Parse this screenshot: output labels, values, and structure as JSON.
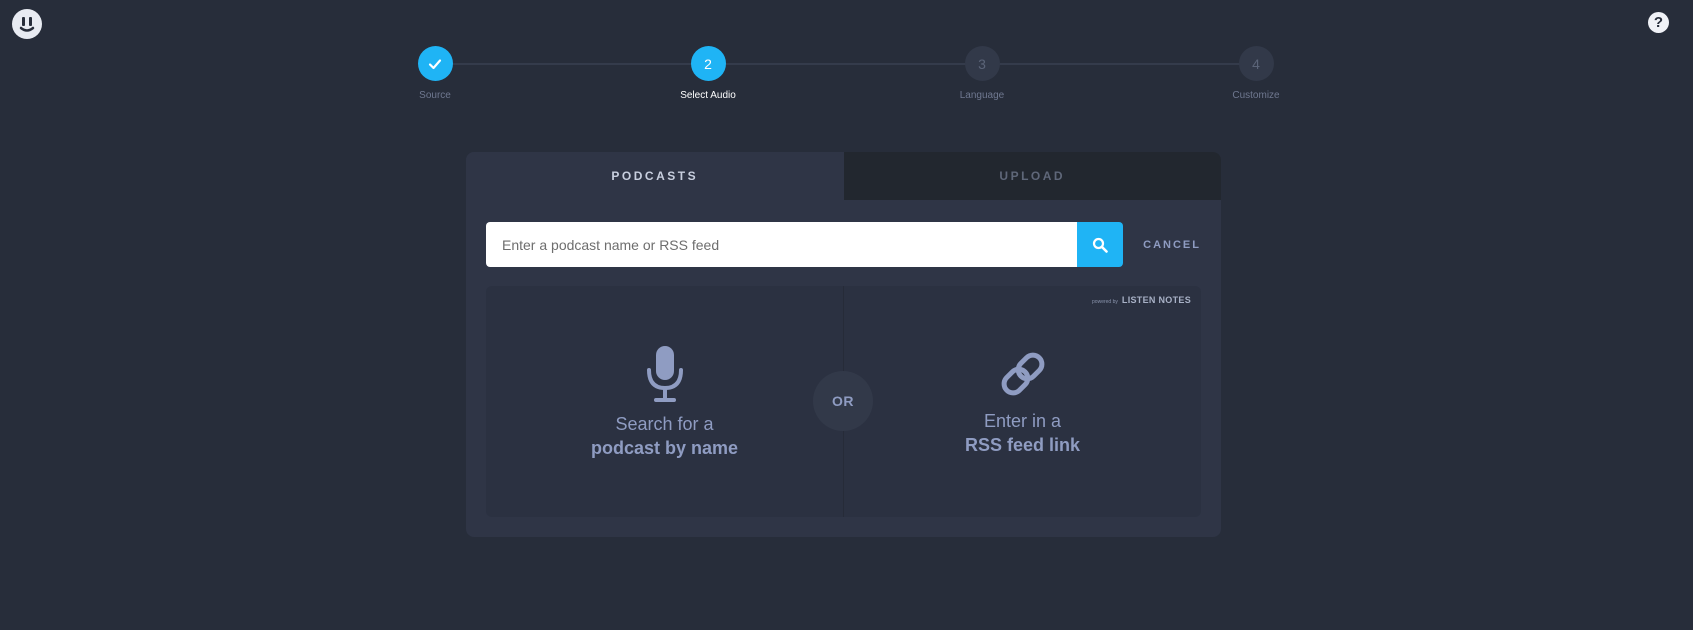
{
  "stepper": {
    "steps": [
      {
        "number": "",
        "label": "Source",
        "state": "done"
      },
      {
        "number": "2",
        "label": "Select Audio",
        "state": "active"
      },
      {
        "number": "3",
        "label": "Language",
        "state": "pending"
      },
      {
        "number": "4",
        "label": "Customize",
        "state": "pending"
      }
    ]
  },
  "tabs": {
    "podcasts": "PODCASTS",
    "upload": "UPLOAD"
  },
  "search": {
    "placeholder": "Enter a podcast name or RSS feed",
    "value": "",
    "cancel_label": "CANCEL"
  },
  "options": {
    "name": {
      "line1": "Search for a",
      "line2": "podcast by name",
      "icon": "microphone-icon"
    },
    "rss": {
      "line1": "Enter in a",
      "line2": "RSS feed link",
      "icon": "link-icon"
    },
    "or_label": "OR",
    "powered_by": "powered by",
    "powered_brand": "LISTEN NOTES"
  },
  "colors": {
    "accent": "#1fb4f5",
    "background": "#272d3a",
    "card": "#2f3546"
  }
}
